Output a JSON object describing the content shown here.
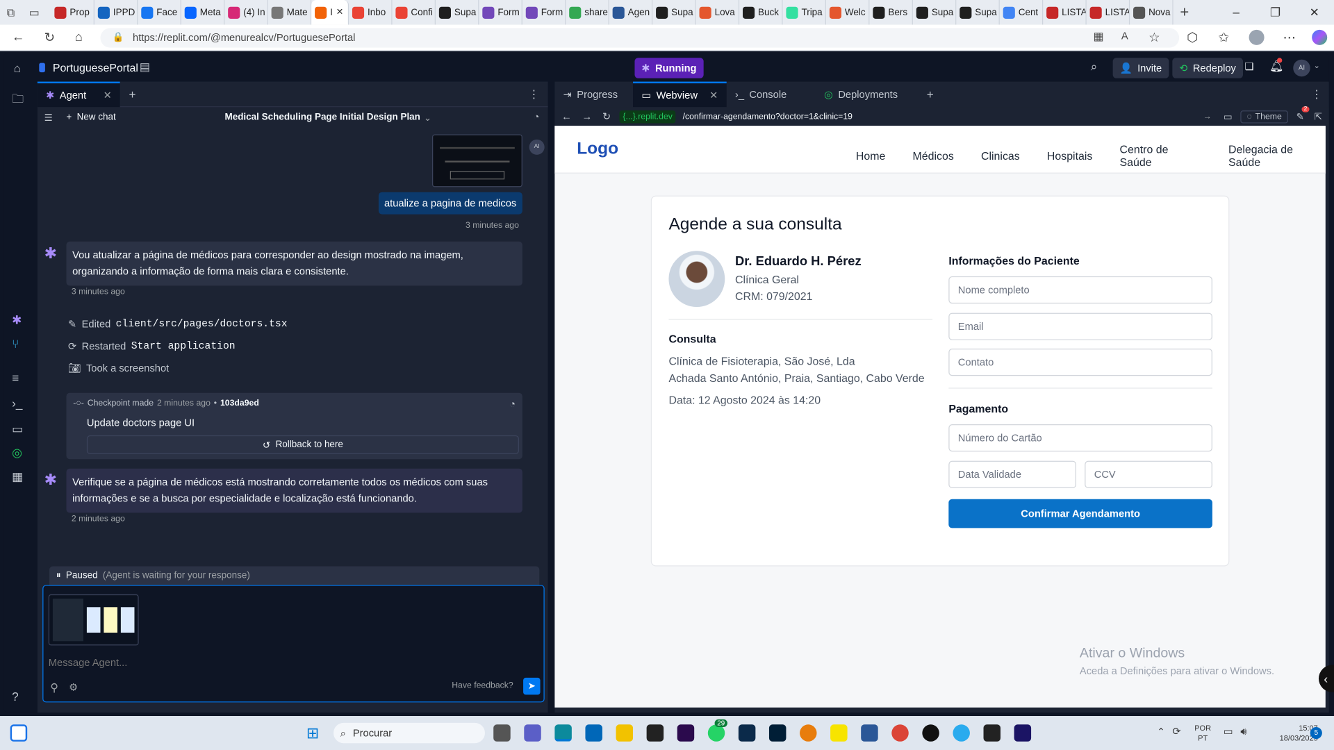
{
  "browser": {
    "tabs": [
      {
        "label": "Prop",
        "color": "#c62828"
      },
      {
        "label": "IPPD",
        "color": "#1565c0"
      },
      {
        "label": "Face",
        "color": "#1877f2"
      },
      {
        "label": "Meta",
        "color": "#0866ff"
      },
      {
        "label": "(4) In",
        "color": "#d62976"
      },
      {
        "label": "Mate",
        "color": "#777777"
      },
      {
        "label": "I",
        "color": "#f26207",
        "active": true
      },
      {
        "label": "Inbo",
        "color": "#ea4335"
      },
      {
        "label": "Confi",
        "color": "#ea4335"
      },
      {
        "label": "Supa",
        "color": "#1f1f1f"
      },
      {
        "label": "Form",
        "color": "#7248b9"
      },
      {
        "label": "Form",
        "color": "#7248b9"
      },
      {
        "label": "share",
        "color": "#34a853"
      },
      {
        "label": "Agen",
        "color": "#2b5797"
      },
      {
        "label": "Supa",
        "color": "#1f1f1f"
      },
      {
        "label": "Lova",
        "color": "#e4572e"
      },
      {
        "label": "Buck",
        "color": "#1f1f1f"
      },
      {
        "label": "Tripa",
        "color": "#34e0a1"
      },
      {
        "label": "Welc",
        "color": "#e4572e"
      },
      {
        "label": "Bers",
        "color": "#1f1f1f"
      },
      {
        "label": "Supa",
        "color": "#1f1f1f"
      },
      {
        "label": "Supa",
        "color": "#1f1f1f"
      },
      {
        "label": "Cent",
        "color": "#4285f4"
      },
      {
        "label": "LISTA",
        "color": "#c62828"
      },
      {
        "label": "LISTA",
        "color": "#c62828"
      },
      {
        "label": "Nova",
        "color": "#555555"
      }
    ],
    "url": "https://replit.com/@menurealcv/PortuguesePortal"
  },
  "replit": {
    "project_name": "PortuguesePortal",
    "run_status": "Running",
    "invite_label": "Invite",
    "redeploy_label": "Redeploy",
    "avatar_initials": "AI",
    "notif_count": "2",
    "agent": {
      "tab_label": "Agent",
      "new_chat_label": "New chat",
      "chat_title": "Medical Scheduling Page Initial Design Plan",
      "user_avatar": "AI",
      "user_message": "atualize a pagina de medicos",
      "user_time": "3 minutes ago",
      "msg1": "Vou atualizar a página de médicos para corresponder ao design mostrado na imagem, organizando a informação de forma mais clara e consistente.",
      "msg1_time": "3 minutes ago",
      "action1_verb": "Edited",
      "action1_target": "client/src/pages/doctors.tsx",
      "action2_verb": "Restarted",
      "action2_target": "Start application",
      "action3": "Took a screenshot",
      "checkpoint_label": "Checkpoint made",
      "checkpoint_time": "2 minutes ago",
      "checkpoint_hash": "103da9ed",
      "checkpoint_title": "Update doctors page UI",
      "rollback_label": "Rollback to here",
      "msg2": "Verifique se a página de médicos está mostrando corretamente todos os médicos com suas informações e se a busca por especialidade e localização está funcionando.",
      "msg2_time": "2 minutes ago",
      "paused_label": "Paused",
      "paused_note": "(Agent is waiting for your response)",
      "input_placeholder": "Message Agent...",
      "feedback_label": "Have feedback?"
    },
    "right_tabs": {
      "progress": "Progress",
      "webview": "Webview",
      "console": "Console",
      "deployments": "Deployments"
    },
    "webview": {
      "domain": "{...}.replit.dev",
      "path": "/confirmar-agendamento?doctor=1&clinic=19",
      "theme_label": "Theme",
      "notif_count": "2"
    }
  },
  "site": {
    "logo": "Logo",
    "nav": [
      "Home",
      "Médicos",
      "Clinicas",
      "Hospitais",
      "Centro de Saúde",
      "Delegacia de Saúde"
    ],
    "page_title": "Agende a sua consulta",
    "doctor_name": "Dr. Eduardo H. Pérez",
    "doctor_specialty": "Clínica Geral",
    "doctor_crm": "CRM: 079/2021",
    "consulta_heading": "Consulta",
    "clinic_name": "Clínica de Fisioterapia, São José, Lda",
    "clinic_address": "Achada Santo António, Praia, Santiago, Cabo Verde",
    "date_text": "Data: 12 Agosto 2024 às 14:20",
    "patient_heading": "Informações do Paciente",
    "ph_name": "Nome completo",
    "ph_email": "Email",
    "ph_contact": "Contato",
    "payment_heading": "Pagamento",
    "ph_card": "Número do Cartão",
    "ph_expiry": "Data Validade",
    "ph_ccv": "CCV",
    "confirm_button": "Confirmar Agendamento",
    "windows_watermark_title": "Ativar o Windows",
    "windows_watermark_sub": "Aceda a Definições para ativar o Windows."
  },
  "taskbar": {
    "search_placeholder": "Procurar",
    "whatsapp_badge": "29",
    "lang_1": "POR",
    "lang_2": "PT",
    "time": "15:07",
    "date": "18/03/2025",
    "notif_count": "5"
  },
  "colors": {
    "accent_blue": "#0079f2",
    "confirm_btn": "#0a72c8",
    "logo_blue": "#1e4fb5",
    "running_purple": "#7c3aed"
  }
}
